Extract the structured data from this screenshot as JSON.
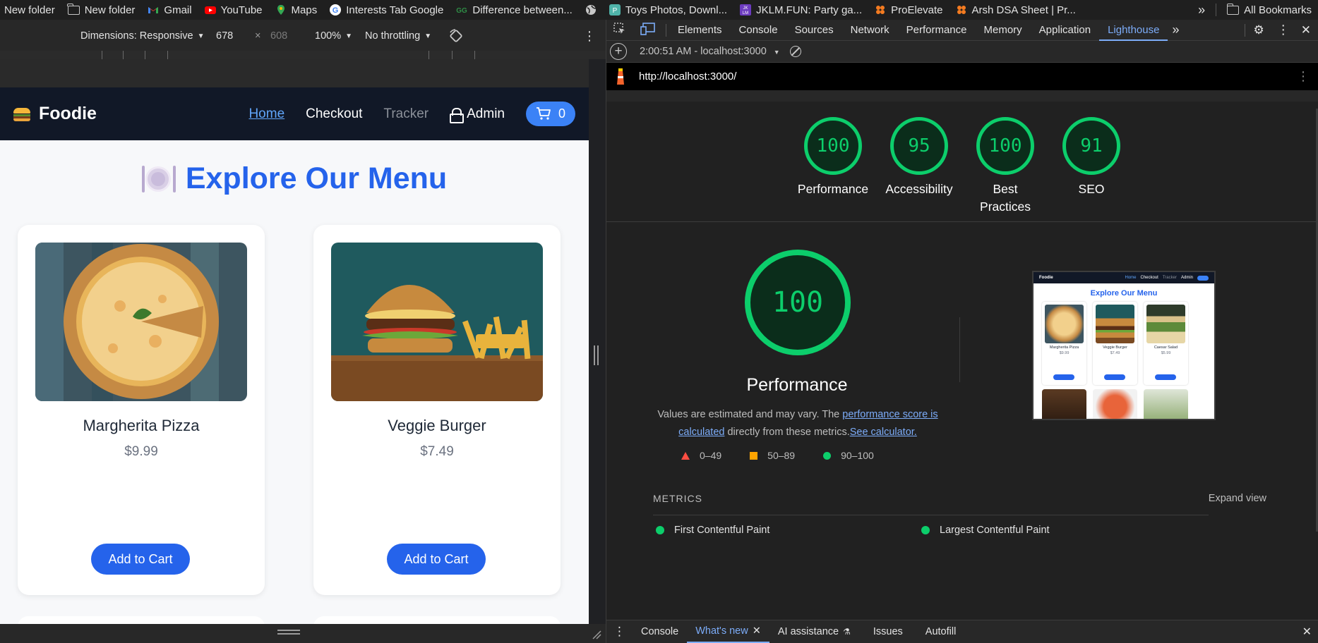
{
  "bookmarks": {
    "items": [
      {
        "label": "New folder",
        "icon": "folder-icon"
      },
      {
        "label": "New folder",
        "icon": "folder-icon"
      },
      {
        "label": "Gmail",
        "icon": "gmail-icon"
      },
      {
        "label": "YouTube",
        "icon": "youtube-icon"
      },
      {
        "label": "Maps",
        "icon": "maps-icon"
      },
      {
        "label": "Interests Tab Google",
        "icon": "google-icon"
      },
      {
        "label": "Difference between...",
        "icon": "gfg-icon"
      },
      {
        "label": "",
        "icon": "globe-icon"
      },
      {
        "label": "Toys Photos, Downl...",
        "icon": "toys-icon"
      },
      {
        "label": "JKLM.FUN: Party ga...",
        "icon": "jklm-icon"
      },
      {
        "label": "ProElevate",
        "icon": "proelevate-icon"
      },
      {
        "label": "Arsh DSA Sheet | Pr...",
        "icon": "arsh-icon"
      }
    ],
    "all_bookmarks": "All Bookmarks"
  },
  "device_toolbar": {
    "dimensions": "Dimensions: Responsive",
    "width": "678",
    "times": "×",
    "height": "608",
    "zoom": "100%",
    "throttling": "No throttling"
  },
  "site": {
    "brand": "Foodie",
    "nav": {
      "home": "Home",
      "checkout": "Checkout",
      "tracker": "Tracker",
      "admin": "Admin",
      "cart_count": "0"
    },
    "menu_title": "Explore Our Menu",
    "cards": [
      {
        "name": "Margherita Pizza",
        "price": "$9.99",
        "button": "Add to Cart"
      },
      {
        "name": "Veggie Burger",
        "price": "$7.49",
        "button": "Add to Cart"
      }
    ]
  },
  "devtools": {
    "tabs": [
      "Elements",
      "Console",
      "Sources",
      "Network",
      "Performance",
      "Memory",
      "Application",
      "Lighthouse"
    ],
    "active_tab": "Lighthouse",
    "report_time": "2:00:51 AM - localhost:3000",
    "url": "http://localhost:3000/",
    "scores": [
      {
        "label": "Performance",
        "value": "100"
      },
      {
        "label": "Accessibility",
        "value": "95"
      },
      {
        "label": "Best Practices",
        "value": "100"
      },
      {
        "label": "SEO",
        "value": "91"
      }
    ],
    "main_score": "100",
    "main_label": "Performance",
    "note_prefix": "Values are estimated and may vary. The ",
    "note_link": "performance score is calculated",
    "note_mid": " directly from these metrics.",
    "note_link2": "See calculator.",
    "legend": [
      "0–49",
      "50–89",
      "90–100"
    ],
    "thumb": {
      "brand": "Foodie",
      "nav": [
        "Home",
        "Checkout",
        "Tracker",
        "Admin"
      ],
      "title": "Explore Our Menu",
      "cards": [
        "Margherita Pizza",
        "Veggie Burger",
        "Caesar Salad"
      ],
      "prices": [
        "$9.99",
        "$7.49",
        "$5.99"
      ],
      "button": "Add to Cart"
    },
    "metrics_label": "METRICS",
    "expand": "Expand view",
    "metrics": [
      "First Contentful Paint",
      "Largest Contentful Paint"
    ],
    "drawer_tabs": [
      "Console",
      "What's new",
      "AI assistance",
      "Issues",
      "Autofill"
    ],
    "drawer_active": "What's new"
  },
  "colors": {
    "accent": "#2563eb",
    "score_green": "#0cce6b",
    "devtools_link": "#7cacf8",
    "site_nav_bg": "#111827"
  }
}
